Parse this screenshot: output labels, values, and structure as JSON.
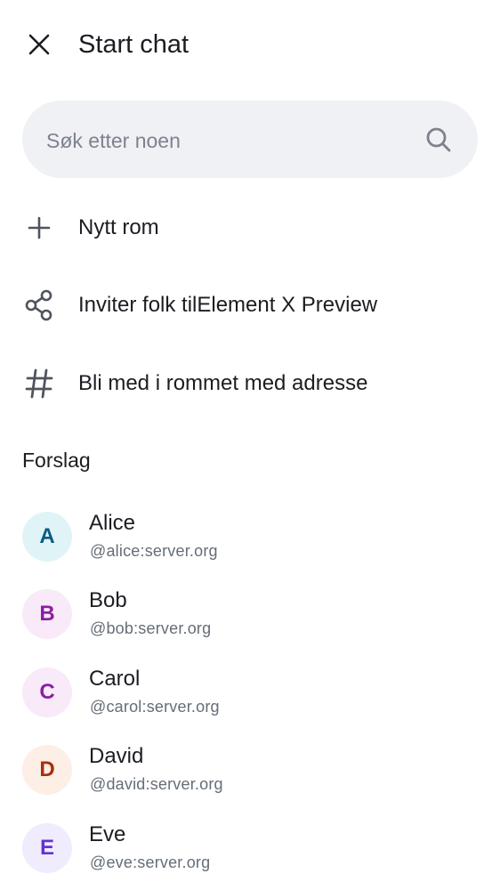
{
  "header": {
    "title": "Start chat",
    "close_icon": "close-icon"
  },
  "search": {
    "placeholder": "Søk etter noen",
    "value": "",
    "icon": "search-icon"
  },
  "actions": [
    {
      "label": "Nytt rom",
      "icon": "plus-icon"
    },
    {
      "label": "Inviter folk tilElement X Preview",
      "icon": "share-icon"
    },
    {
      "label": "Bli med i rommet med adresse",
      "icon": "hash-icon"
    }
  ],
  "suggestions": {
    "title": "Forslag",
    "users": [
      {
        "initial": "A",
        "name": "Alice",
        "id": "@alice:server.org",
        "bg": "#e0f4f8",
        "fg": "#0b5c80"
      },
      {
        "initial": "B",
        "name": "Bob",
        "id": "@bob:server.org",
        "bg": "#f8eaf8",
        "fg": "#8a1fa0"
      },
      {
        "initial": "C",
        "name": "Carol",
        "id": "@carol:server.org",
        "bg": "#f8eaf8",
        "fg": "#8a1fa0"
      },
      {
        "initial": "D",
        "name": "David",
        "id": "@david:server.org",
        "bg": "#fdeee6",
        "fg": "#a8300d"
      },
      {
        "initial": "E",
        "name": "Eve",
        "id": "@eve:server.org",
        "bg": "#f0ecfd",
        "fg": "#6333d2"
      }
    ]
  },
  "colors": {
    "text_primary": "#1b1d22",
    "text_secondary": "#656d77",
    "search_bg": "#eff1f5",
    "icon": "#4f555e"
  }
}
